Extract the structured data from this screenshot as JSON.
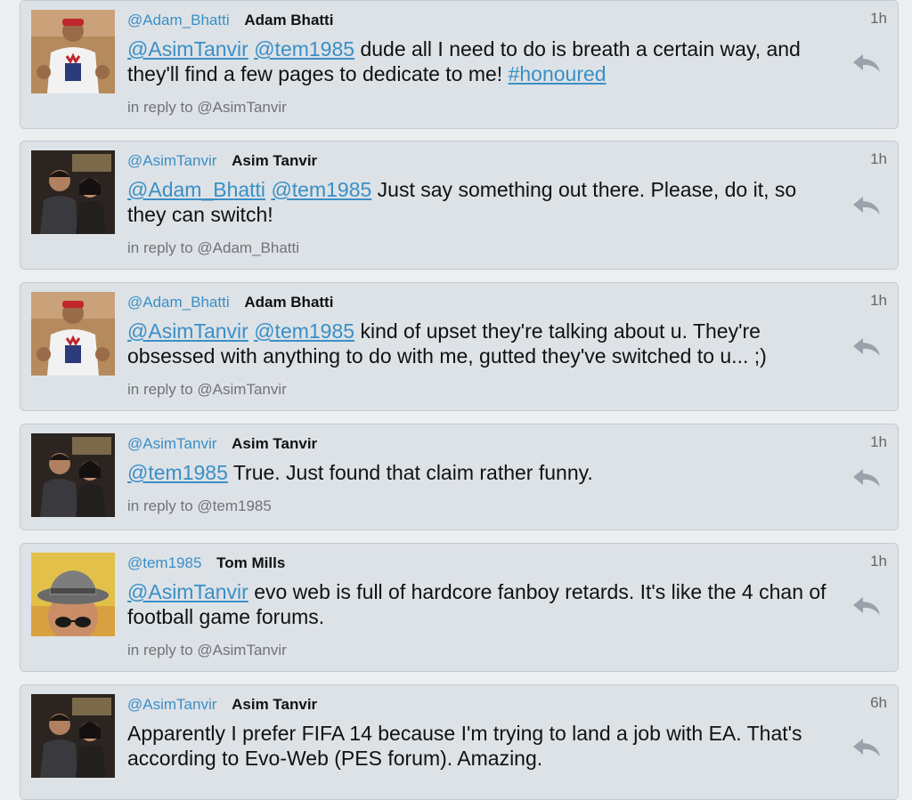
{
  "tweets": [
    {
      "handle": "@Adam_Bhatti",
      "name": "Adam Bhatti",
      "time": "1h",
      "avatar": "avatar-adam",
      "mentions": [
        "@AsimTanvir",
        "@tem1985"
      ],
      "text": " dude all I need to do is breath a certain way, and they'll find a few pages to dedicate to me! ",
      "hashtag": "#honoured",
      "reply_to": "in reply to @AsimTanvir"
    },
    {
      "handle": "@AsimTanvir",
      "name": "Asim Tanvir",
      "time": "1h",
      "avatar": "avatar-asim",
      "mentions": [
        "@Adam_Bhatti",
        "@tem1985"
      ],
      "text": " Just say something out there. Please, do it, so they can switch!",
      "reply_to": "in reply to @Adam_Bhatti"
    },
    {
      "handle": "@Adam_Bhatti",
      "name": "Adam Bhatti",
      "time": "1h",
      "avatar": "avatar-adam",
      "mentions": [
        "@AsimTanvir",
        "@tem1985"
      ],
      "text": " kind of upset they're talking about u. They're obsessed with anything to do with me, gutted they've switched to u... ;)",
      "reply_to": "in reply to @AsimTanvir"
    },
    {
      "handle": "@AsimTanvir",
      "name": "Asim Tanvir",
      "time": "1h",
      "avatar": "avatar-asim",
      "mentions": [
        "@tem1985"
      ],
      "text": " True. Just found that claim rather funny.",
      "reply_to": "in reply to @tem1985"
    },
    {
      "handle": "@tem1985",
      "name": "Tom Mills",
      "time": "1h",
      "avatar": "avatar-tom",
      "mentions": [
        "@AsimTanvir"
      ],
      "text": " evo web is full of hardcore fanboy retards. It's like the 4 chan of football game forums.",
      "reply_to": "in reply to @AsimTanvir"
    },
    {
      "handle": "@AsimTanvir",
      "name": "Asim Tanvir",
      "time": "6h",
      "avatar": "avatar-asim",
      "mentions": [],
      "text": "Apparently I prefer FIFA 14 because I'm trying to land a job with EA. That's according to Evo-Web (PES forum). Amazing.",
      "reply_to": ""
    }
  ],
  "icons": {
    "reply": "reply-arrow-icon"
  },
  "colors": {
    "link": "#3a8fc5",
    "card_bg": "#dde2e7",
    "page_bg": "#eceef0"
  }
}
